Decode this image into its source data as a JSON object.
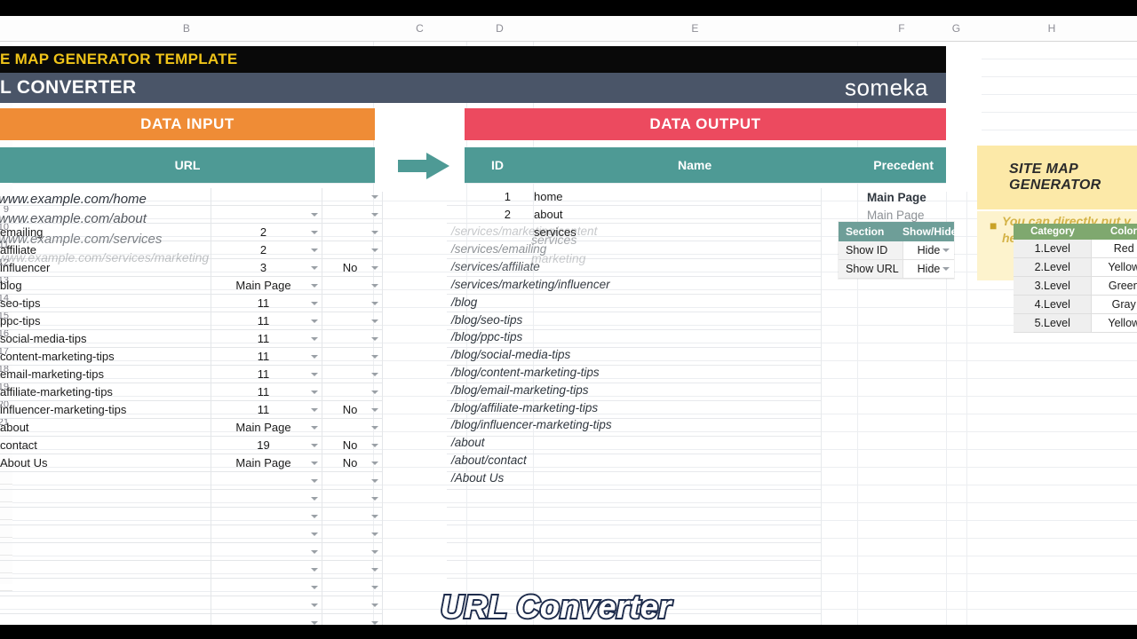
{
  "window": {
    "app": "spreadsheet",
    "column_headers": [
      "B",
      "C",
      "D",
      "E",
      "F",
      "G",
      "H"
    ]
  },
  "header": {
    "template_title": "E MAP GENERATOR TEMPLATE",
    "tool_title": "L CONVERTER",
    "brand": "someka",
    "brand_colors": {
      "black_bar": "#090909",
      "title_yellow": "#f0c419",
      "slate": "#4a5568"
    }
  },
  "panels": {
    "input": {
      "banner": "DATA INPUT",
      "banner_color": "#ef8c36",
      "column": "URL",
      "subhead_color": "#4e9a95"
    },
    "output": {
      "banner": "DATA OUTPUT",
      "banner_color": "#ec4a5f",
      "columns": {
        "id": "ID",
        "name": "Name",
        "precedent": "Precedent"
      }
    },
    "arrow_icon": "right-arrow-icon"
  },
  "row_numbers": [
    "",
    "",
    "",
    "9",
    "10",
    "11",
    "12",
    "13",
    "14",
    "15",
    "16",
    "17",
    "18",
    "19",
    "20",
    "21",
    "",
    "",
    "",
    "",
    "",
    "",
    "",
    "",
    ""
  ],
  "input_rows": [
    {
      "name": "",
      "precedent": "",
      "flag": ""
    },
    {
      "name": "",
      "precedent": "",
      "flag": ""
    },
    {
      "name": "emailing",
      "precedent": "2",
      "flag": ""
    },
    {
      "name": "affiliate",
      "precedent": "2",
      "flag": ""
    },
    {
      "name": "influencer",
      "precedent": "3",
      "flag": "No"
    },
    {
      "name": "blog",
      "precedent": "Main Page",
      "flag": ""
    },
    {
      "name": "seo-tips",
      "precedent": "11",
      "flag": ""
    },
    {
      "name": "ppc-tips",
      "precedent": "11",
      "flag": ""
    },
    {
      "name": "social-media-tips",
      "precedent": "11",
      "flag": ""
    },
    {
      "name": "content-marketing-tips",
      "precedent": "11",
      "flag": ""
    },
    {
      "name": "email-marketing-tips",
      "precedent": "11",
      "flag": ""
    },
    {
      "name": "affiliate-marketing-tips",
      "precedent": "11",
      "flag": ""
    },
    {
      "name": "influencer-marketing-tips",
      "precedent": "11",
      "flag": "No"
    },
    {
      "name": "about",
      "precedent": "Main Page",
      "flag": ""
    },
    {
      "name": "contact",
      "precedent": "19",
      "flag": "No"
    },
    {
      "name": "About Us",
      "precedent": "Main Page",
      "flag": "No"
    },
    {
      "name": "",
      "precedent": "",
      "flag": ""
    },
    {
      "name": "",
      "precedent": "",
      "flag": ""
    },
    {
      "name": "",
      "precedent": "",
      "flag": ""
    },
    {
      "name": "",
      "precedent": "",
      "flag": ""
    },
    {
      "name": "",
      "precedent": "",
      "flag": ""
    },
    {
      "name": "",
      "precedent": "",
      "flag": ""
    },
    {
      "name": "",
      "precedent": "",
      "flag": ""
    },
    {
      "name": "",
      "precedent": "",
      "flag": ""
    },
    {
      "name": "",
      "precedent": "",
      "flag": ""
    }
  ],
  "input_ghost_urls": [
    "/www.example.com/home",
    "/www.example.com/about",
    "/www.example.com/services",
    "/www.example.com/services/marketing"
  ],
  "output_rows": [
    {
      "id": "1",
      "name": "home"
    },
    {
      "id": "2",
      "name": "about"
    },
    {
      "id": "",
      "name": "services"
    },
    {
      "id": "",
      "name": ""
    },
    {
      "id": "",
      "name": ""
    }
  ],
  "output_ghost_paths": [
    "/services/marketing/content",
    "/services/emailing",
    "/services/affiliate",
    "/services/marketing/influencer",
    "/blog",
    "/blog/seo-tips",
    "/blog/ppc-tips",
    "/blog/social-media-tips",
    "/blog/content-marketing-tips",
    "/blog/email-marketing-tips",
    "/blog/affiliate-marketing-tips",
    "/blog/influencer-marketing-tips",
    "/about",
    "/about/contact",
    "/About Us"
  ],
  "output_ghost_names": [
    "marketing"
  ],
  "precedent_ghosts": [
    "Main Page",
    "Main Page",
    "Main Page"
  ],
  "section_table": {
    "headers": [
      "Section",
      "Show/Hide"
    ],
    "rows": [
      {
        "section": "Show ID",
        "value": "Hide"
      },
      {
        "section": "Show URL",
        "value": "Hide"
      }
    ],
    "header_color": "#6e9e98"
  },
  "site_map_note": {
    "title": "SITE MAP GENERATOR",
    "body": "You can directly put y here. Based on \"/\" m",
    "bg": "#fce9a8"
  },
  "category_table": {
    "headers": [
      "Category",
      "Color"
    ],
    "rows": [
      {
        "category": "1.Level",
        "color": "Red"
      },
      {
        "category": "2.Level",
        "color": "Yellow"
      },
      {
        "category": "3.Level",
        "color": "Green"
      },
      {
        "category": "4.Level",
        "color": "Gray"
      },
      {
        "category": "5.Level",
        "color": "Yellow"
      }
    ],
    "header_color": "#7fa86f"
  },
  "caption": {
    "text": "URL Converter",
    "fill": "#ffffff",
    "outline": "#1f2d4d"
  }
}
